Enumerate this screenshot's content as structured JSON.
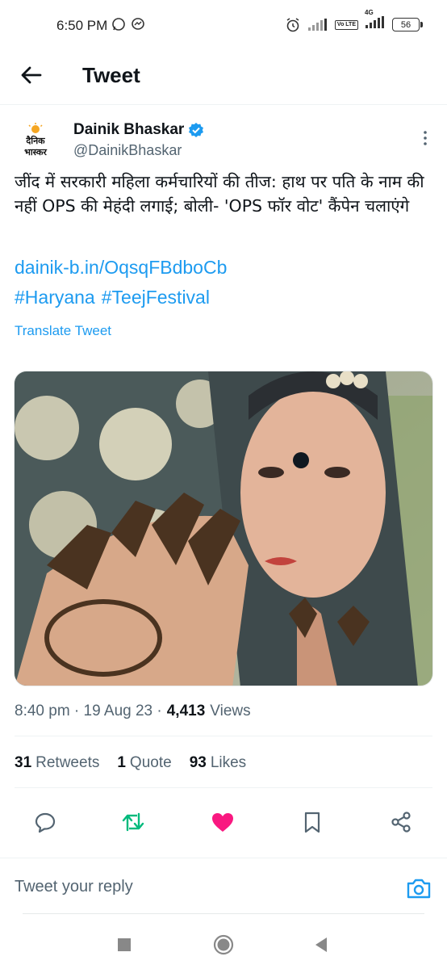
{
  "status_bar": {
    "time": "6:50 PM",
    "network": "4G",
    "volte": "Vo LTE",
    "battery": "56"
  },
  "header": {
    "title": "Tweet"
  },
  "tweet": {
    "author_name": "Dainik Bhaskar",
    "author_handle": "@DainikBhaskar",
    "verified": true,
    "avatar_text_top": "दैनिक",
    "avatar_text_bottom": "भास्कर",
    "text": "जींद में सरकारी महिला कर्मचारियों की तीज: हाथ पर पति के नाम की नहीं OPS की मेहंदी लगाई; बोली- 'OPS फॉर वोट' कैंपेन चलाएंगे",
    "link": "dainik-b.in/OqsqFBdboCb",
    "hashtags": [
      "#Haryana",
      "#TeejFestival"
    ],
    "translate_label": "Translate Tweet",
    "timestamp": "8:40 pm · 19 Aug 23 ·",
    "views_count": "4,413",
    "views_label": "Views",
    "retweets_count": "31",
    "retweets_label": "Retweets",
    "quotes_count": "1",
    "quotes_label": "Quote",
    "likes_count": "93",
    "likes_label": "Likes"
  },
  "actions": {
    "reply_icon": "comment-icon",
    "retweet_icon": "retweet-icon",
    "like_icon": "heart-icon",
    "bookmark_icon": "bookmark-icon",
    "share_icon": "share-icon"
  },
  "reply": {
    "placeholder": "Tweet your reply"
  },
  "colors": {
    "accent": "#1d9bf0",
    "retweet": "#00ba7c",
    "like": "#f91880",
    "text": "#0f1419",
    "secondary": "#536471"
  }
}
